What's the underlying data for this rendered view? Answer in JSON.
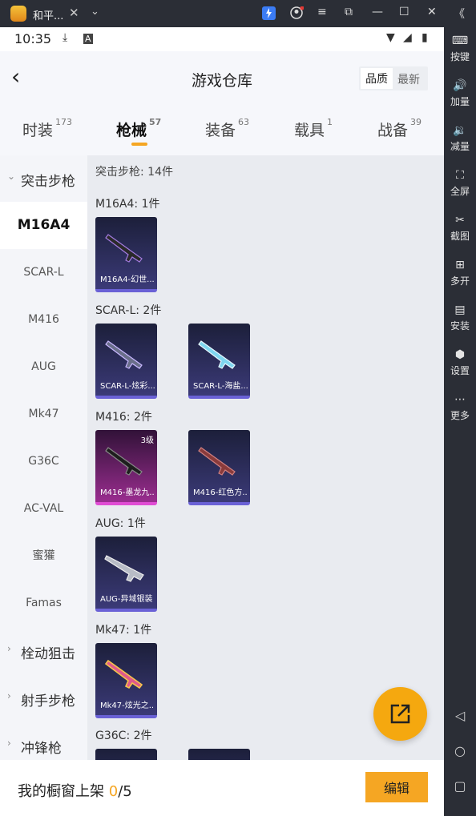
{
  "emulator": {
    "app_title": "和平...",
    "close_glyph": "✕",
    "menu_glyph": "⌄",
    "window_buttons": [
      "≡",
      "⧉",
      "—",
      "☐",
      "✕",
      "《"
    ],
    "side": [
      {
        "icon": "keyboard-icon",
        "glyph": "⌨",
        "label": "按键"
      },
      {
        "icon": "volume-up-icon",
        "glyph": "🔊",
        "label": "加量"
      },
      {
        "icon": "volume-down-icon",
        "glyph": "🔉",
        "label": "减量"
      },
      {
        "icon": "fullscreen-icon",
        "glyph": "⛶",
        "label": "全屏"
      },
      {
        "icon": "screenshot-icon",
        "glyph": "✂",
        "label": "截图"
      },
      {
        "icon": "multi-instance-icon",
        "glyph": "⊞",
        "label": "多开"
      },
      {
        "icon": "apk-install-icon",
        "glyph": "▤",
        "label": "安装"
      },
      {
        "icon": "settings-icon",
        "glyph": "⬢",
        "label": "设置"
      },
      {
        "icon": "more-icon",
        "glyph": "⋯",
        "label": "更多"
      }
    ],
    "nav": [
      "◁",
      "○",
      "▢"
    ]
  },
  "status_bar": {
    "time": "10:35",
    "wifi": "▼",
    "signal": "◢",
    "battery": "▮"
  },
  "header": {
    "title": "游戏仓库",
    "back": "‹",
    "sort_quality": "品质",
    "sort_latest": "最新"
  },
  "categories": [
    {
      "label": "时装",
      "count": "173"
    },
    {
      "label": "枪械",
      "count": "57"
    },
    {
      "label": "装备",
      "count": "63"
    },
    {
      "label": "载具",
      "count": "1"
    },
    {
      "label": "战备",
      "count": "39"
    }
  ],
  "left_nav": {
    "group_open": "突击步枪",
    "subs": [
      "M16A4",
      "SCAR-L",
      "M416",
      "AUG",
      "Mk47",
      "G36C",
      "AC-VAL",
      "蜜獾",
      "Famas"
    ],
    "groups_closed": [
      "栓动狙击",
      "射手步枪",
      "冲锋枪"
    ],
    "chev_open": "⌄",
    "chev_closed": "›"
  },
  "content": {
    "total": "突击步枪: 14件",
    "sections": [
      {
        "title": "M16A4: 1件",
        "items": [
          {
            "name": "M16A4-幻世...",
            "rarity": "purple"
          }
        ]
      },
      {
        "title": "SCAR-L: 2件",
        "items": [
          {
            "name": "SCAR-L-炫彩...",
            "rarity": "purple"
          },
          {
            "name": "SCAR-L-海盐...",
            "rarity": "purple"
          }
        ]
      },
      {
        "title": "M416: 2件",
        "items": [
          {
            "name": "M416-墨龙九...",
            "rarity": "pink",
            "level": "3级"
          },
          {
            "name": "M416-红色方...",
            "rarity": "purple"
          }
        ]
      },
      {
        "title": "AUG: 1件",
        "items": [
          {
            "name": "AUG-异域银装",
            "rarity": "purple"
          }
        ]
      },
      {
        "title": "Mk47: 1件",
        "items": [
          {
            "name": "Mk47-炫光之...",
            "rarity": "purple"
          }
        ]
      },
      {
        "title": "G36C: 2件",
        "items": []
      }
    ]
  },
  "bottom": {
    "label": "我的橱窗上架 ",
    "count": "0",
    "sep": "/5",
    "edit": "编辑"
  }
}
